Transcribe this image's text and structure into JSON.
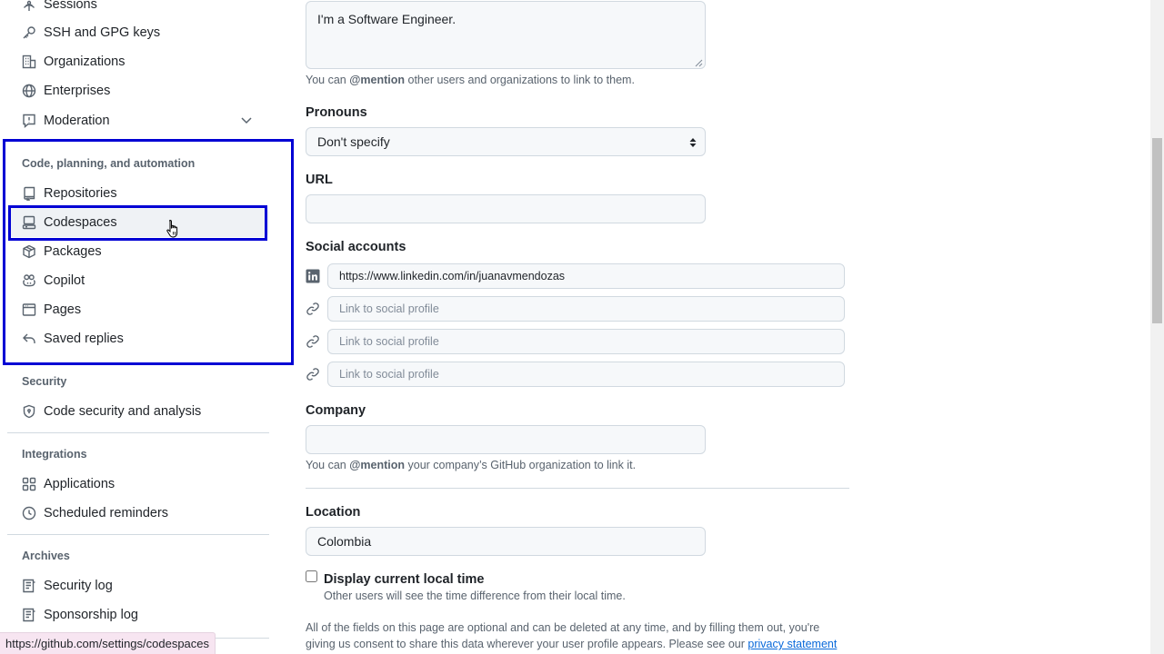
{
  "sidebar": {
    "top_items": [
      {
        "label": "Sessions",
        "icon": "broadcast-icon"
      },
      {
        "label": "SSH and GPG keys",
        "icon": "key-icon"
      },
      {
        "label": "Organizations",
        "icon": "organization-icon"
      },
      {
        "label": "Enterprises",
        "icon": "globe-icon"
      },
      {
        "label": "Moderation",
        "icon": "report-icon"
      }
    ],
    "section_code": {
      "heading": "Code, planning, and automation",
      "items": [
        {
          "label": "Repositories",
          "icon": "repo-icon"
        },
        {
          "label": "Codespaces",
          "icon": "codespaces-icon"
        },
        {
          "label": "Packages",
          "icon": "package-icon"
        },
        {
          "label": "Copilot",
          "icon": "copilot-icon"
        },
        {
          "label": "Pages",
          "icon": "browser-icon"
        },
        {
          "label": "Saved replies",
          "icon": "reply-icon"
        }
      ]
    },
    "section_security": {
      "heading": "Security",
      "items": [
        {
          "label": "Code security and analysis",
          "icon": "shield-lock-icon"
        }
      ]
    },
    "section_integrations": {
      "heading": "Integrations",
      "items": [
        {
          "label": "Applications",
          "icon": "apps-icon"
        },
        {
          "label": "Scheduled reminders",
          "icon": "clock-icon"
        }
      ]
    },
    "section_archives": {
      "heading": "Archives",
      "items": [
        {
          "label": "Security log",
          "icon": "log-icon"
        },
        {
          "label": "Sponsorship log",
          "icon": "log-icon"
        }
      ]
    }
  },
  "form": {
    "bio": {
      "value": "I'm a Software Engineer.",
      "hint_prefix": "You can ",
      "hint_mention": "@mention",
      "hint_suffix": " other users and organizations to link to them."
    },
    "pronouns": {
      "label": "Pronouns",
      "value": "Don't specify"
    },
    "url": {
      "label": "URL",
      "value": ""
    },
    "social": {
      "label": "Social accounts",
      "links": [
        {
          "value": "https://www.linkedin.com/in/juanavmendozas",
          "icon": "linkedin-icon"
        },
        {
          "placeholder": "Link to social profile",
          "icon": "link-icon"
        },
        {
          "placeholder": "Link to social profile",
          "icon": "link-icon"
        },
        {
          "placeholder": "Link to social profile",
          "icon": "link-icon"
        }
      ]
    },
    "company": {
      "label": "Company",
      "value": "",
      "hint_prefix": "You can ",
      "hint_mention": "@mention",
      "hint_suffix": " your company’s GitHub organization to link it."
    },
    "location": {
      "label": "Location",
      "value": "Colombia"
    },
    "local_time": {
      "label": "Display current local time",
      "checked": false,
      "hint": "Other users will see the time difference from their local time."
    },
    "footer": {
      "line1": "All of the fields on this page are optional and can be deleted at any time, and by filling them out, you're",
      "line2": "giving us consent to share this data wherever your user profile appears. Please see our ",
      "link": "privacy statement"
    }
  },
  "statusbar": {
    "url": "https://github.com/settings/codespaces"
  },
  "colors": {
    "highlight": "#0000d4",
    "link": "#0969da",
    "status_bg": "#f7e5f1"
  }
}
